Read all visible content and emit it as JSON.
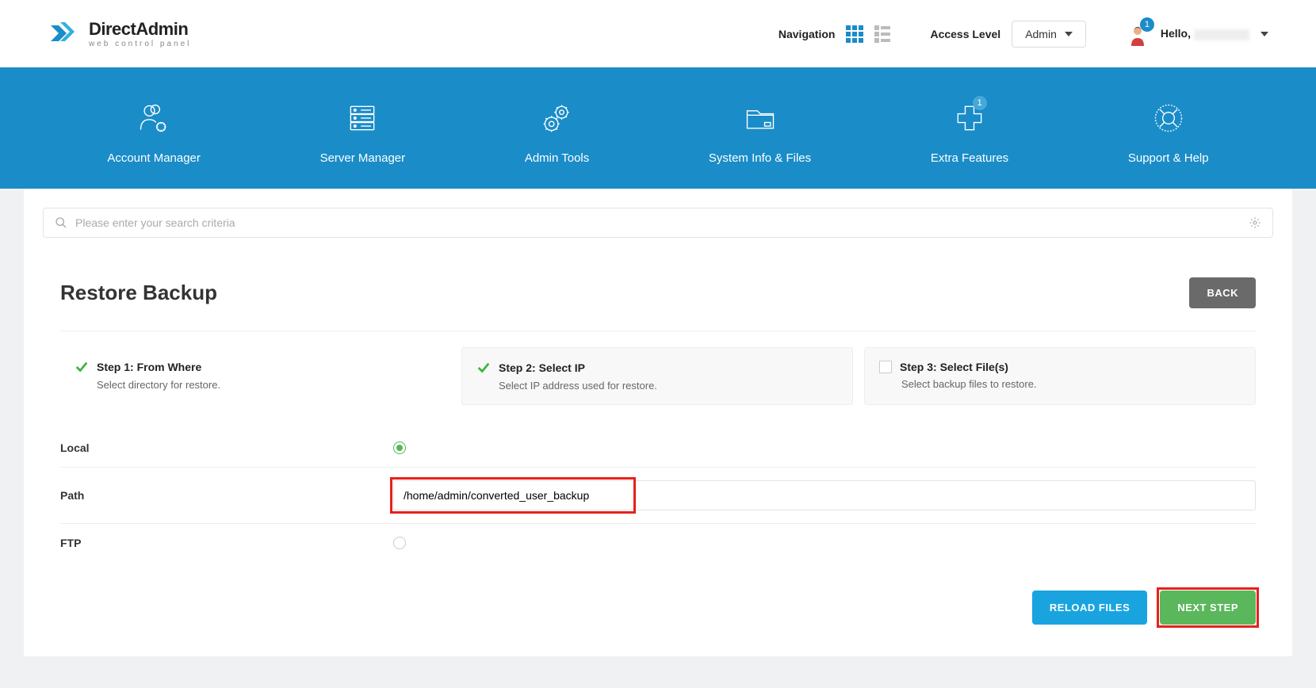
{
  "brand": {
    "name": "DirectAdmin",
    "sub": "web control panel"
  },
  "topbar": {
    "navigation_label": "Navigation",
    "access_label": "Access Level",
    "access_value": "Admin",
    "avatar_badge": "1",
    "hello_prefix": "Hello,"
  },
  "ribbon": [
    {
      "label": "Account Manager"
    },
    {
      "label": "Server Manager"
    },
    {
      "label": "Admin Tools"
    },
    {
      "label": "System Info & Files"
    },
    {
      "label": "Extra Features",
      "badge": "1"
    },
    {
      "label": "Support & Help"
    }
  ],
  "search": {
    "placeholder": "Please enter your search criteria"
  },
  "page": {
    "title": "Restore Backup",
    "back": "BACK"
  },
  "steps": [
    {
      "title": "Step 1: From Where",
      "desc": "Select directory for restore.",
      "checked": true
    },
    {
      "title": "Step 2: Select IP",
      "desc": "Select IP address used for restore.",
      "checked": true,
      "boxed": true
    },
    {
      "title": "Step 3: Select File(s)",
      "desc": "Select backup files to restore.",
      "checked": false,
      "boxed": true
    }
  ],
  "form": {
    "local_label": "Local",
    "path_label": "Path",
    "path_value": "/home/admin/converted_user_backup",
    "ftp_label": "FTP"
  },
  "actions": {
    "reload": "RELOAD FILES",
    "next": "NEXT STEP"
  }
}
